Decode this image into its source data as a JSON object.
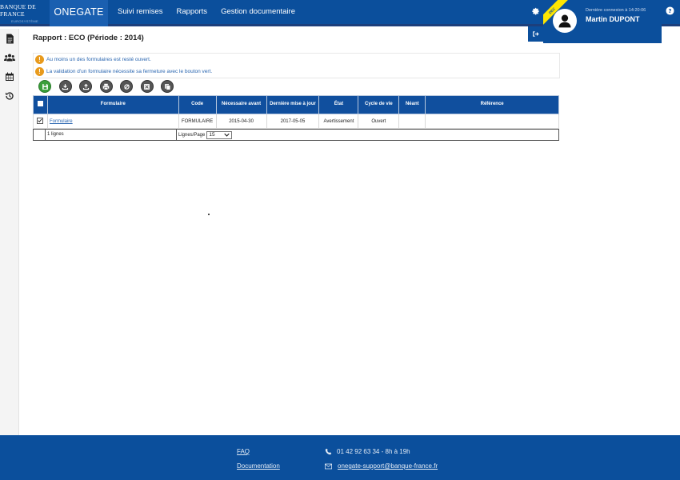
{
  "header": {
    "logo_line1": "BANQUE DE FRANCE",
    "logo_line2": "EUROSYSTÈME",
    "brand": "ONEGATE",
    "nav": [
      "Suivi remises",
      "Rapports",
      "Gestion documentaire"
    ]
  },
  "user": {
    "ribbon": "DEC",
    "last_connection": "Dernière connexion à 14:20:06",
    "name": "Martin DUPONT"
  },
  "page": {
    "title": "Rapport : ECO (Période : 2014)",
    "messages": [
      "Au moins un des formulaires est resté ouvert.",
      "La validation d'un formulaire nécessite sa fermeture avec le bouton vert."
    ]
  },
  "table": {
    "headers": [
      "Formulaire",
      "Code",
      "Nécessaire avant",
      "Dernière mise à jour",
      "État",
      "Cycle de vie",
      "Néant",
      "Référence"
    ],
    "rows": [
      {
        "formulaire": "Formulaire",
        "code": "FORMULAIRE",
        "necessaire": "2015-04-30",
        "maj": "2017-05-05",
        "etat": "Avertissement",
        "cycle": "Ouvert",
        "neant": "",
        "reference": ""
      }
    ]
  },
  "pager": {
    "count": "1 lignes",
    "label": "Lignes/Page",
    "value": "15"
  },
  "footer": {
    "faq": "FAQ",
    "documentation": "Documentation",
    "phone": "01 42 92 63 34  - 8h à 19h",
    "email": "onegate-support@banque-france.fr"
  },
  "colors": {
    "header_blue": "#0b4f9c",
    "table_header": "#104f9e",
    "warning": "#e89a1c",
    "ribbon": "#ffe600"
  }
}
